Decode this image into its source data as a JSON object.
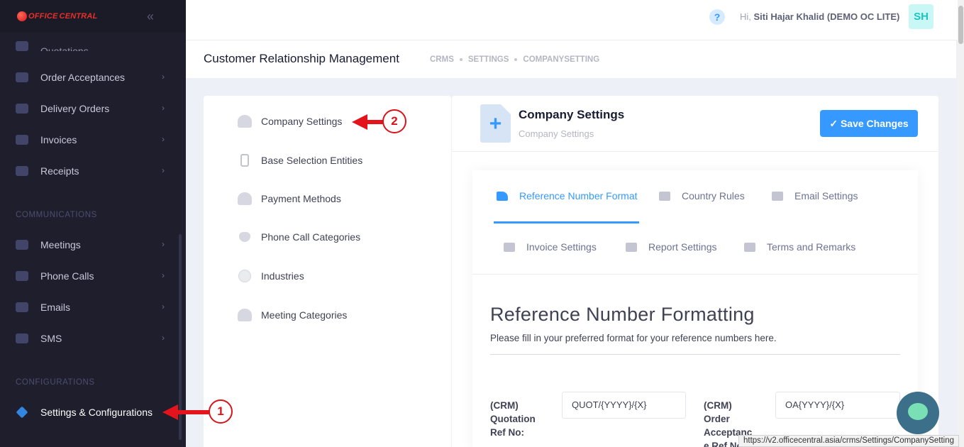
{
  "sidebar": {
    "brand": {
      "logo_part1": "OFFICE",
      "logo_part2": "CENTRAL"
    },
    "items": [
      {
        "label": "Quotations",
        "icon": "quotation-icon",
        "partial": true
      },
      {
        "label": "Order Acceptances",
        "icon": "order-acceptance-icon"
      },
      {
        "label": "Delivery Orders",
        "icon": "delivery-icon"
      },
      {
        "label": "Invoices",
        "icon": "invoice-icon"
      },
      {
        "label": "Receipts",
        "icon": "receipt-icon"
      }
    ],
    "section_communications": "COMMUNICATIONS",
    "comm_items": [
      {
        "label": "Meetings",
        "icon": "meeting-icon"
      },
      {
        "label": "Phone Calls",
        "icon": "phone-icon"
      },
      {
        "label": "Emails",
        "icon": "email-icon"
      },
      {
        "label": "SMS",
        "icon": "sms-icon"
      }
    ],
    "section_configurations": "CONFIGURATIONS",
    "active_item": {
      "label": "Settings & Configurations",
      "icon": "settings-diamond-icon"
    }
  },
  "header": {
    "greeting_prefix": "Hi,",
    "user_name": "Siti Hajar Khalid (DEMO OC LITE)",
    "avatar_initials": "SH",
    "help_symbol": "?"
  },
  "subheader": {
    "title": "Customer Relationship Management",
    "breadcrumbs": [
      "CRMS",
      "SETTINGS",
      "COMPANYSETTING"
    ]
  },
  "settings_menu": [
    {
      "label": "Company Settings",
      "icon": "user-icon"
    },
    {
      "label": "Base Selection Entities",
      "icon": "mobile-icon"
    },
    {
      "label": "Payment Methods",
      "icon": "group-icon"
    },
    {
      "label": "Phone Call Categories",
      "icon": "heart-icon"
    },
    {
      "label": "Industries",
      "icon": "smile-icon"
    },
    {
      "label": "Meeting Categories",
      "icon": "group-icon"
    }
  ],
  "card": {
    "title": "Company Settings",
    "subtitle": "Company Settings",
    "save_label": "Save Changes",
    "tabs": [
      {
        "label": "Reference Number Format",
        "active": true
      },
      {
        "label": "Country Rules"
      },
      {
        "label": "Email Settings"
      },
      {
        "label": "Invoice Settings"
      },
      {
        "label": "Report Settings"
      },
      {
        "label": "Terms and Remarks"
      }
    ],
    "section_heading": "Reference Number Formatting",
    "section_desc": "Please fill in your preferred format for your reference numbers here.",
    "fields": [
      {
        "label_lines": [
          "(CRM)",
          "Quotation",
          "Ref No:"
        ],
        "value": "QUOT/{YYYY}/{X}"
      },
      {
        "label_lines": [
          "(CRM)",
          "Order",
          "Acceptanc",
          "e Ref No:"
        ],
        "value": "OA{YYYY}/{X}"
      }
    ]
  },
  "status_url": "https://v2.officecentral.asia/crms/Settings/CompanySetting",
  "annotations": [
    {
      "number": "1"
    },
    {
      "number": "2"
    }
  ],
  "colors": {
    "primary": "#3699ff",
    "sidebar": "#1e1e2d",
    "annotation": "#e3141b"
  }
}
